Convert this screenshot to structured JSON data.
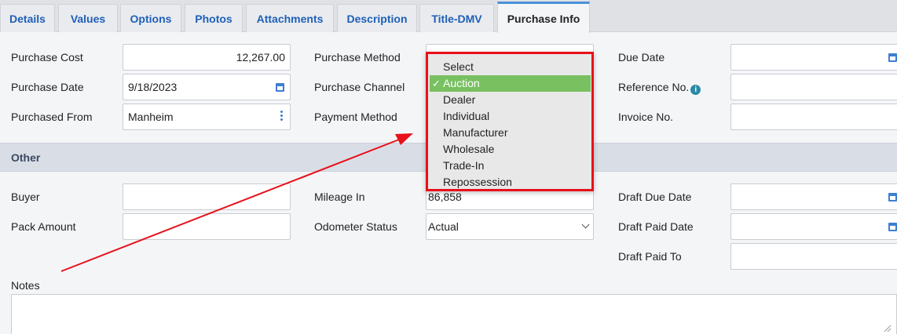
{
  "tabs": [
    {
      "label": "Details"
    },
    {
      "label": "Values"
    },
    {
      "label": "Options"
    },
    {
      "label": "Photos"
    },
    {
      "label": "Attachments"
    },
    {
      "label": "Description"
    },
    {
      "label": "Title-DMV"
    },
    {
      "label": "Purchase Info"
    }
  ],
  "purchase": {
    "cost_label": "Purchase Cost",
    "cost_value": "12,267.00",
    "date_label": "Purchase Date",
    "date_value": "9/18/2023",
    "from_label": "Purchased From",
    "from_value": "Manheim",
    "method_label": "Purchase Method",
    "channel_label": "Purchase Channel",
    "payment_label": "Payment Method",
    "due_date_label": "Due Date",
    "reference_label": "Reference No.",
    "invoice_label": "Invoice No."
  },
  "section_other": "Other",
  "other": {
    "buyer_label": "Buyer",
    "pack_label": "Pack Amount",
    "mileage_label": "Mileage In",
    "mileage_value": "86,858",
    "odometer_label": "Odometer Status",
    "odometer_value": "Actual",
    "draft_due_label": "Draft Due Date",
    "draft_paid_label": "Draft Paid Date",
    "draft_paid_to_label": "Draft Paid To"
  },
  "notes_label": "Notes",
  "dropdown": {
    "check": "✓",
    "options": [
      "Select",
      "Auction",
      "Dealer",
      "Individual",
      "Manufacturer",
      "Wholesale",
      "Trade-In",
      "Repossession"
    ],
    "selected": "Auction"
  },
  "colors": {
    "accent": "#1f5fb8",
    "highlight": "#78c060",
    "annotation": "#e8101a"
  }
}
